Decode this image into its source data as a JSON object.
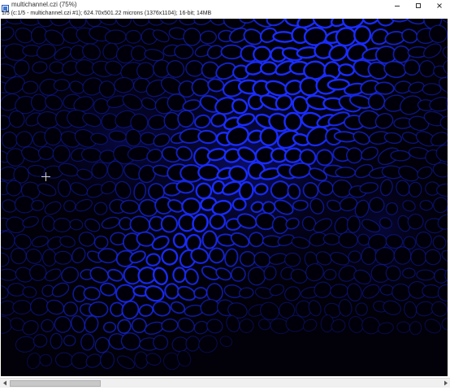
{
  "window": {
    "title": "multichannel.czi (75%)",
    "app_icon": "imagej-icon",
    "controls": [
      "minimize-icon",
      "maximize-icon",
      "close-icon"
    ]
  },
  "image": {
    "info": "1/5 (c:1/5 - multichannel.czi #1); 624.70x501.22 microns (1376x1104); 16-bit; 14MB",
    "channel_color": "#1a2cff",
    "background_color": "#020008"
  },
  "scrollbar": {
    "left_arrow": "chevron-left-icon",
    "right_arrow": "chevron-right-icon"
  }
}
